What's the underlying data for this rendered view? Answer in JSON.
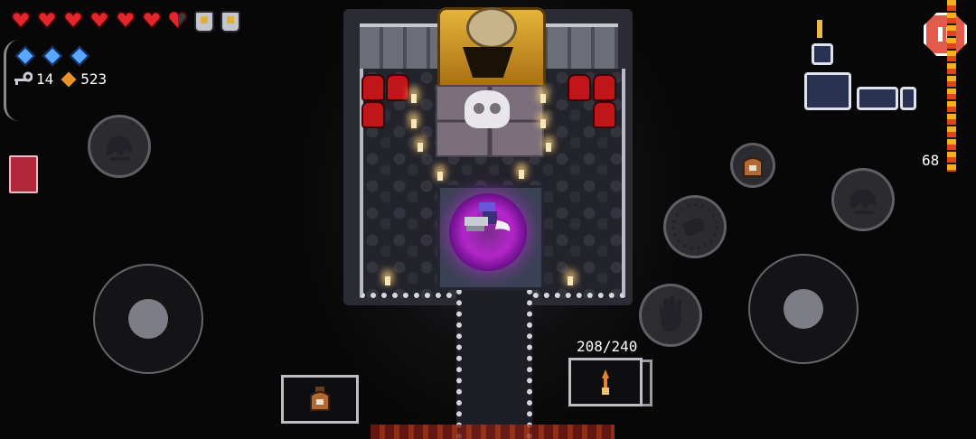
{
  "hud": {
    "hearts_full": 6,
    "hearts_half": 1,
    "armor_count": 2,
    "blanks_count": 3,
    "keys": "14",
    "currency": "523"
  },
  "weapon": {
    "ammo": "208/240"
  },
  "map": {
    "kill_count": "68"
  },
  "icons": {
    "pause": "pause-icon",
    "dodge_roll": "ghost-dodge-icon",
    "reload": "reload-icon",
    "interact": "hand-icon",
    "active_item": "jug-item-icon",
    "book": "ammonomicon-icon"
  },
  "colors": {
    "heart": "#e3262b",
    "blank": "#5aa7ff",
    "currency": "#e8932a",
    "portal": "#b226c8",
    "pause_button": "#e35b4a"
  }
}
